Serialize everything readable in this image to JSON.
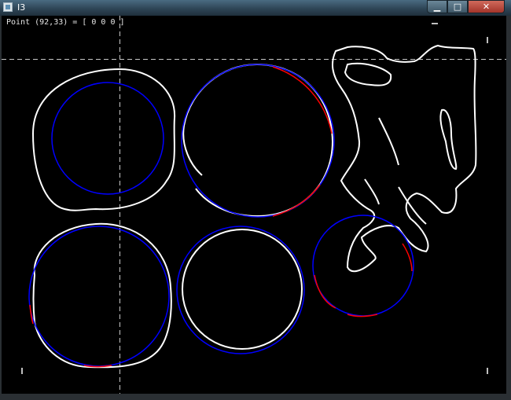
{
  "window": {
    "title": "I3",
    "icon": "app-window-icon",
    "minimize_glyph": "▁",
    "maximize_glyph": "□",
    "close_glyph": "✕"
  },
  "status_bar": {
    "text": "Point (92,33) = [ 0 0 0 ]"
  },
  "colors": {
    "background": "#000000",
    "detected_contour": "#ffffff",
    "fitted_circle": "#0000ff",
    "mismatch": "#ff0000",
    "crosshair": "#c8c8c8"
  }
}
